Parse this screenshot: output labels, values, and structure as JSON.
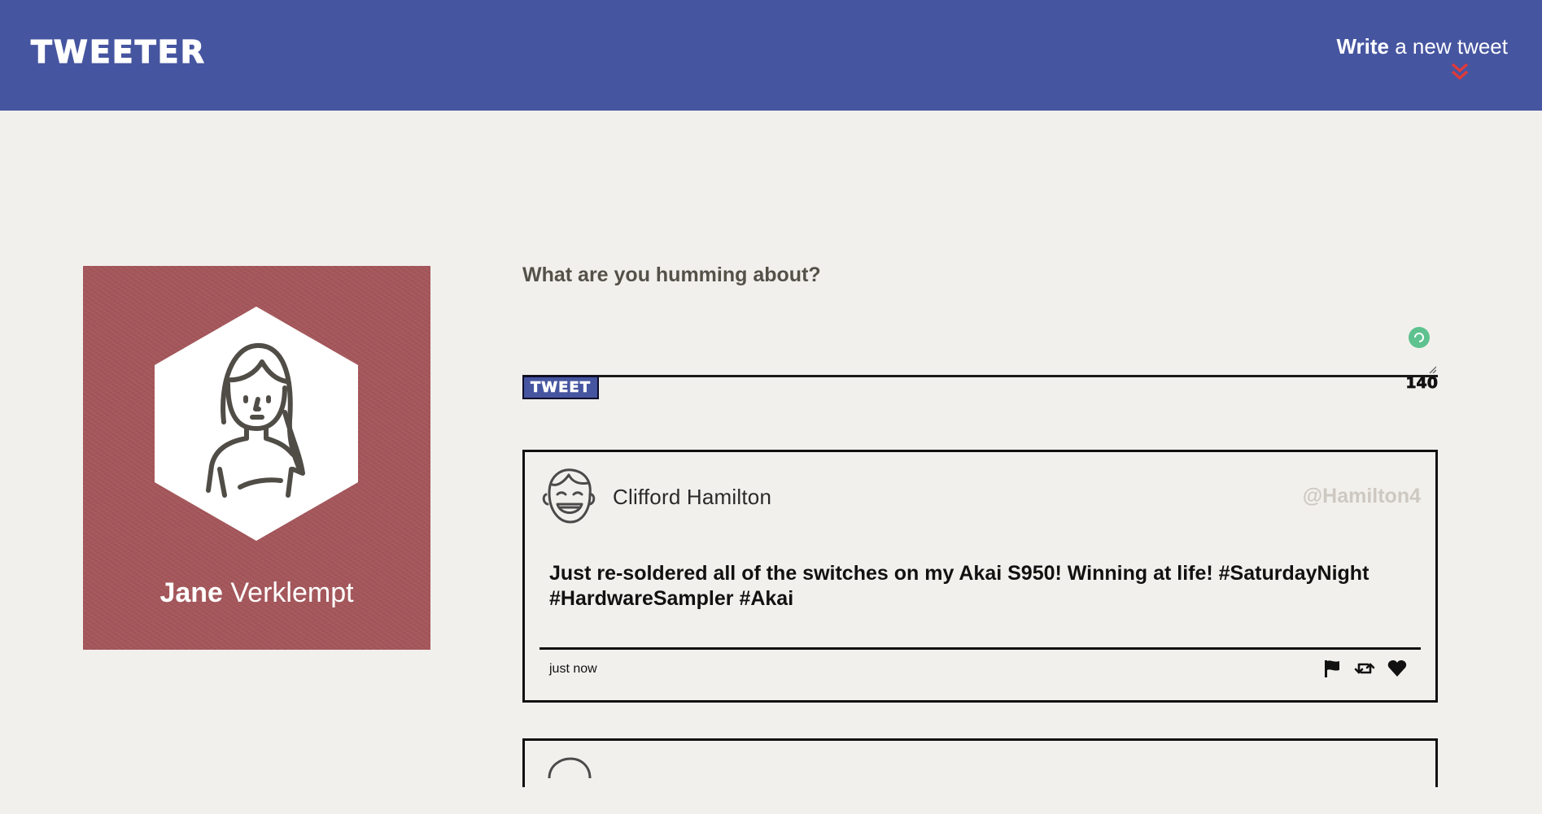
{
  "nav": {
    "brand": "TWEETER",
    "compose_toggle": {
      "strong": "Write",
      "light": " a new tweet"
    },
    "accent_color": "#e03a3a",
    "background_color": "#4655a0"
  },
  "profile": {
    "first_name": "Jane",
    "last_name": " Verklempt",
    "background_color": "#a4565a",
    "avatar_icon": "woman-avatar-icon"
  },
  "compose": {
    "label": "What are you humming about?",
    "text": "",
    "button_label": "TWEET",
    "counter": "140"
  },
  "tweets": [
    {
      "name": "Clifford Hamilton",
      "handle": "@Hamilton4",
      "text": "Just re-soldered all of the switches on my Akai S950! Winning at life! #SaturdayNight #HardwareSampler #Akai",
      "time": "just now",
      "avatar_icon": "laughing-man-avatar-icon",
      "actions": [
        "flag-icon",
        "retweet-icon",
        "heart-icon"
      ]
    }
  ]
}
